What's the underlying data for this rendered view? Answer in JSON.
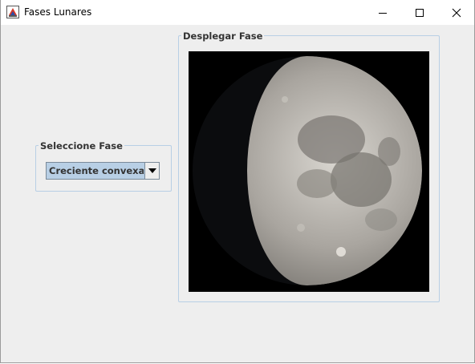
{
  "window": {
    "title": "Fases Lunares",
    "controls": [
      "minimize-icon",
      "maximize-icon",
      "close-icon"
    ]
  },
  "select_group": {
    "legend": "Seleccione Fase",
    "combo_value": "Creciente convexa"
  },
  "display_group": {
    "legend": "Desplegar Fase",
    "image": "waxing-gibbous-moon"
  },
  "colors": {
    "window_bg": "#eeeeee",
    "group_border": "#b8cfe5",
    "combo_bg": "#b8cfe5",
    "label_text": "#333333",
    "image_bg": "#000000"
  }
}
